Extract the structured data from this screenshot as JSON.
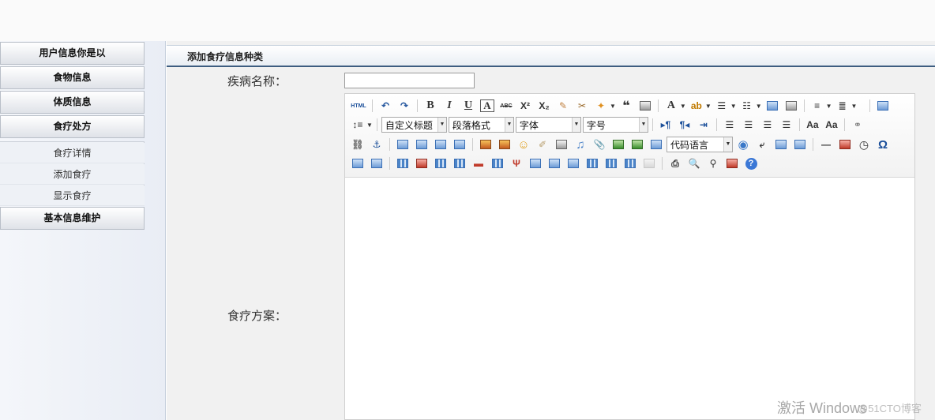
{
  "sidebar": {
    "menus": [
      {
        "label": "用户信息你是以"
      },
      {
        "label": "食物信息"
      },
      {
        "label": "体质信息"
      },
      {
        "label": "食疗处方"
      }
    ],
    "submenu": [
      {
        "label": "食疗详情"
      },
      {
        "label": "添加食疗"
      },
      {
        "label": "显示食疗"
      }
    ],
    "maintenance": {
      "label": "基本信息维护"
    }
  },
  "main": {
    "title": "添加食疗信息种类",
    "disease_label": "疾病名称：",
    "disease_value": "",
    "plan_label": "食疗方案："
  },
  "toolbar": {
    "html_label": "HTML",
    "bold": "B",
    "italic": "I",
    "underline": "U",
    "fontborder": "A",
    "strike": "ABC",
    "superscript": "X²",
    "subscript": "X₂",
    "quote": "❝",
    "forecolor": "A",
    "custom_heading": "自定义标题",
    "paragraph": "段落格式",
    "font_family": "字体",
    "font_size": "字号",
    "code_language": "代码语言",
    "link_icon": "link-icon",
    "omega": "Ω",
    "help": "?"
  },
  "watermark": {
    "text": "激活 Windows",
    "text2": "@51CTO博客"
  }
}
